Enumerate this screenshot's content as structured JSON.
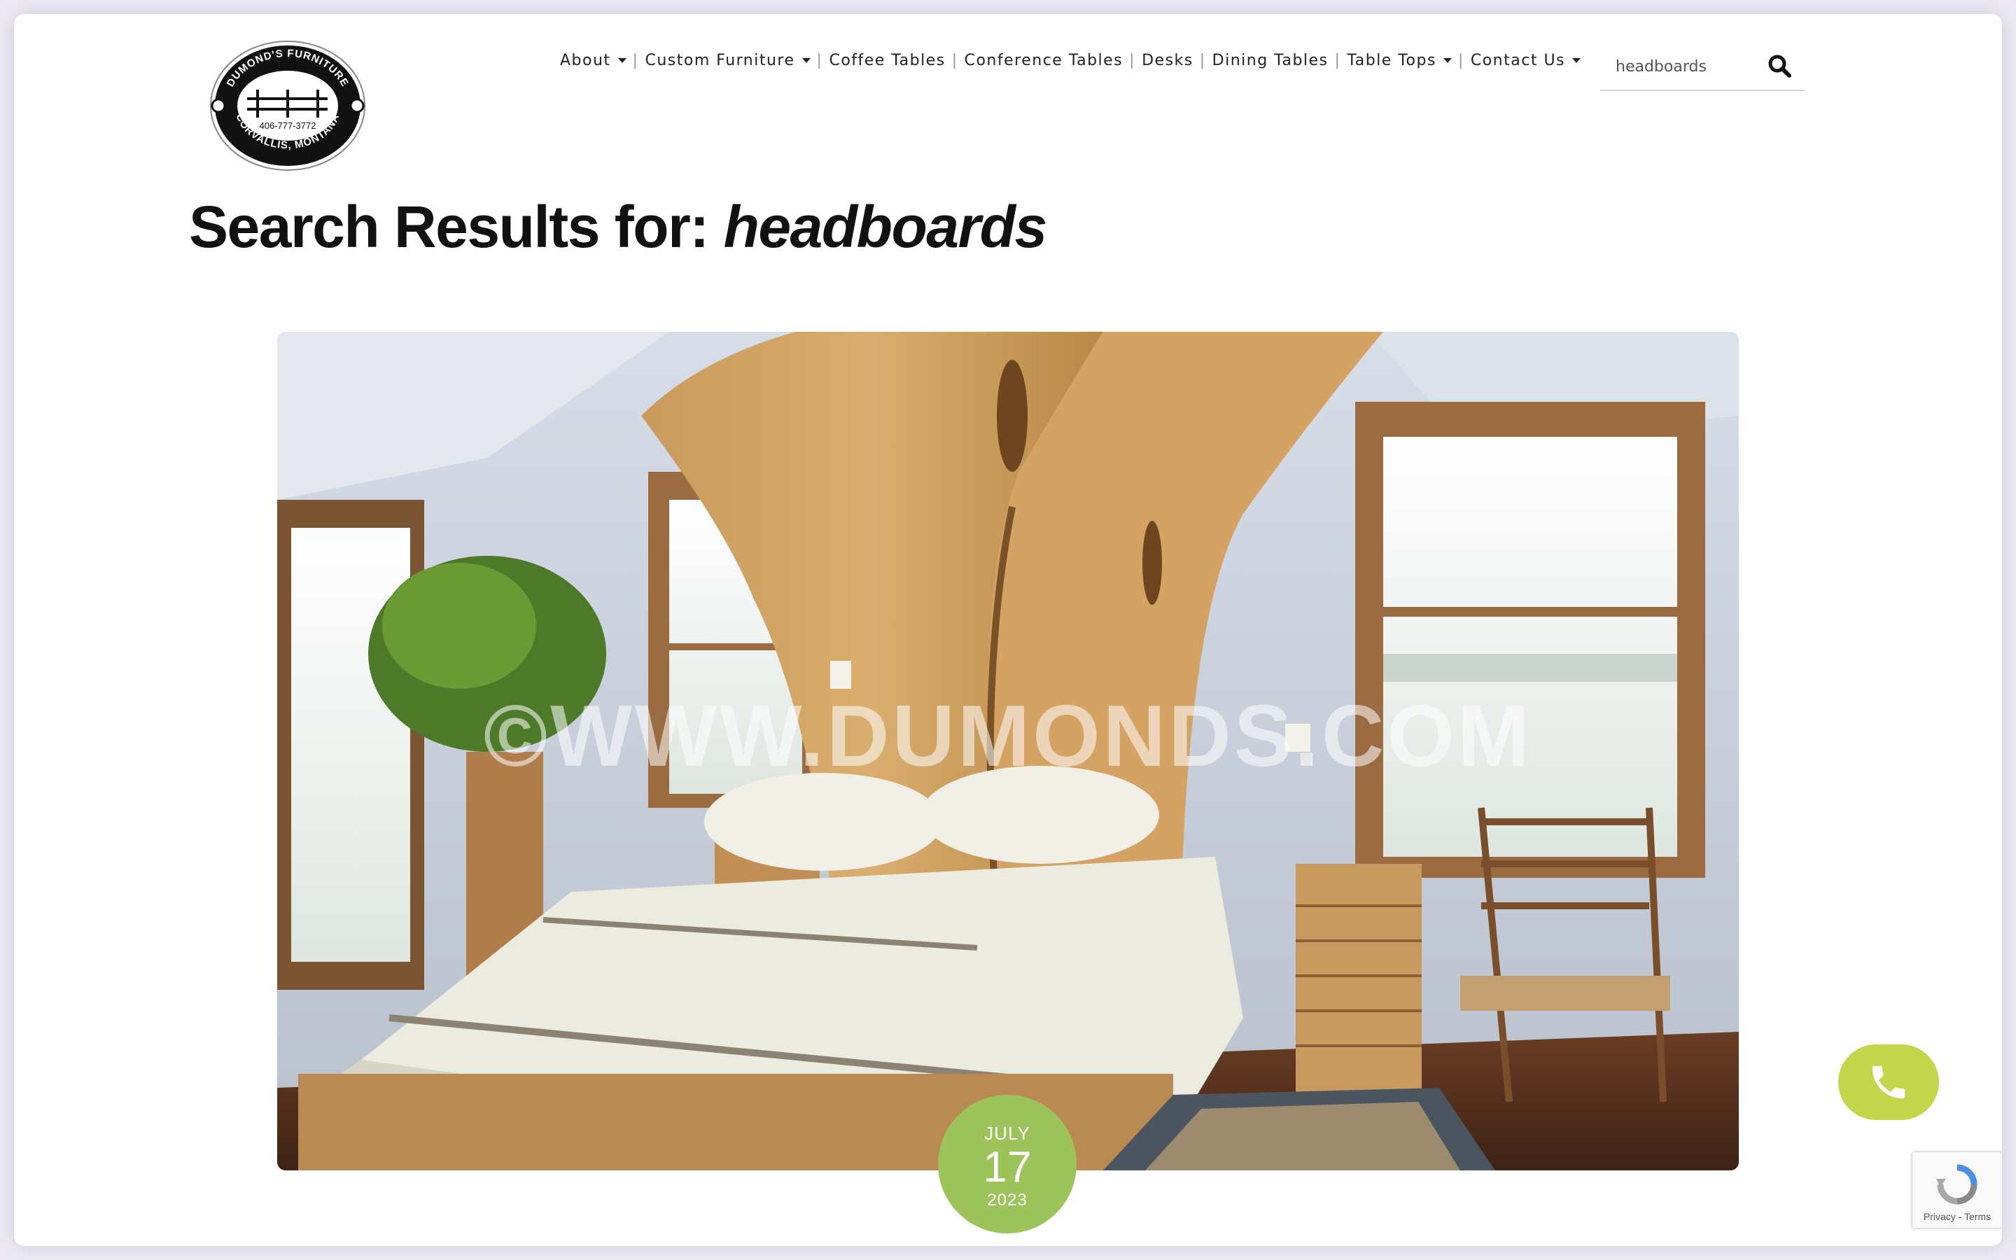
{
  "logo": {
    "top_text": "DUMOND'S FURNITURE",
    "phone": "406-777-3772",
    "bottom_text": "CORVALLIS, MONTANA"
  },
  "nav": {
    "items": [
      {
        "label": "About",
        "has_dropdown": true
      },
      {
        "label": "Custom Furniture",
        "has_dropdown": true
      },
      {
        "label": "Coffee Tables",
        "has_dropdown": false
      },
      {
        "label": "Conference Tables",
        "has_dropdown": false
      },
      {
        "label": "Desks",
        "has_dropdown": false
      },
      {
        "label": "Dining Tables",
        "has_dropdown": false
      },
      {
        "label": "Table Tops",
        "has_dropdown": true
      },
      {
        "label": "Contact Us",
        "has_dropdown": true
      }
    ],
    "separator": "|"
  },
  "search": {
    "value": "headboards",
    "icon": "search-icon"
  },
  "heading": {
    "prefix": "Search Results for: ",
    "query": "headboards"
  },
  "post": {
    "image_watermark": "©WWW.DUMONDS.COM",
    "date": {
      "month": "JULY",
      "day": "17",
      "year": "2023"
    }
  },
  "phone_button": {
    "icon": "phone-icon"
  },
  "recaptcha": {
    "links": "Privacy - Terms"
  },
  "colors": {
    "badge": "#9dc35b",
    "phone_button": "#c3d54a",
    "text": "#111111"
  }
}
